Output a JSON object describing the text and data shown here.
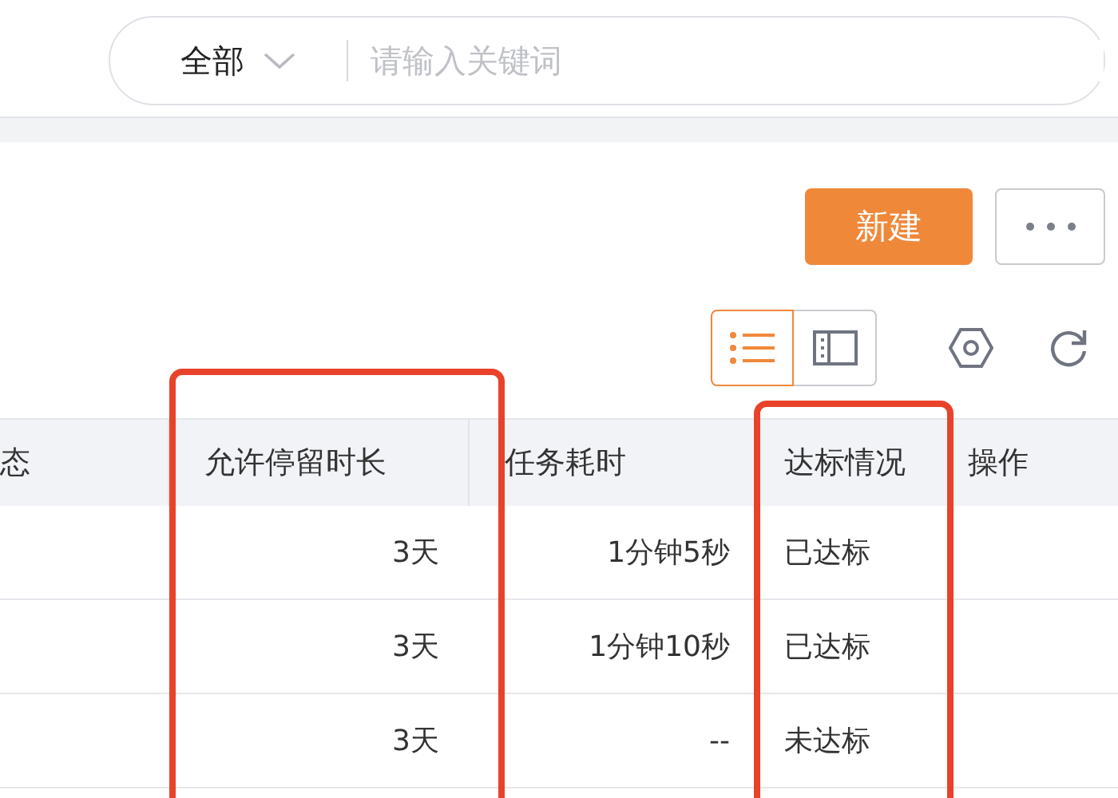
{
  "search": {
    "scope": "全部",
    "placeholder": "请输入关键词"
  },
  "actions": {
    "create": "新建"
  },
  "views": [
    {
      "kind": "list",
      "selected": true
    },
    {
      "kind": "panel",
      "selected": false
    }
  ],
  "table": {
    "columns": [
      {
        "label": "态",
        "highlighted": false
      },
      {
        "label": "允许停留时长",
        "highlighted": true
      },
      {
        "label": "任务耗时",
        "highlighted": false
      },
      {
        "label": "达标情况",
        "highlighted": true
      },
      {
        "label": "操作",
        "highlighted": false
      }
    ],
    "rows": [
      {
        "cells": [
          "",
          "3天",
          "1分钟5秒",
          "已达标",
          ""
        ]
      },
      {
        "cells": [
          "",
          "3天",
          "1分钟10秒",
          "已达标",
          ""
        ]
      },
      {
        "cells": [
          "",
          "3天",
          "--",
          "未达标",
          ""
        ]
      },
      {
        "cells": [
          "",
          "",
          "",
          "",
          ""
        ]
      }
    ]
  }
}
